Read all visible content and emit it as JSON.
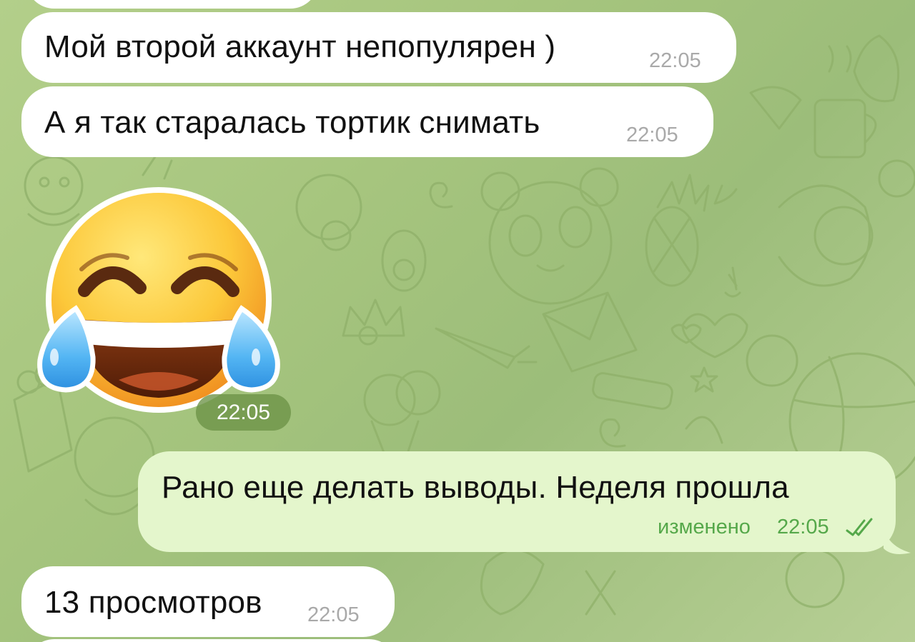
{
  "messages": [
    {
      "id": "m1",
      "direction": "incoming",
      "text": "Мой второй аккаунт непопулярен )",
      "time": "22:05"
    },
    {
      "id": "m2",
      "direction": "incoming",
      "text": "А я так старалась тортик снимать",
      "time": "22:05"
    },
    {
      "id": "m3",
      "direction": "incoming",
      "type": "sticker",
      "sticker": "tears-of-joy-emoji",
      "time": "22:05"
    },
    {
      "id": "m4",
      "direction": "outgoing",
      "text": "Рано еще делать выводы. Неделя прошла",
      "edited_label": "изменено",
      "time": "22:05",
      "status_icon": "double-check-icon"
    },
    {
      "id": "m5",
      "direction": "incoming",
      "text": "13 просмотров",
      "time": "22:05"
    }
  ],
  "colors": {
    "incoming_bubble": "#ffffff",
    "outgoing_bubble": "#e4f6cc",
    "outgoing_meta": "#55a84a",
    "time_gray": "#a9a9a9",
    "background": "#a6c57e"
  }
}
